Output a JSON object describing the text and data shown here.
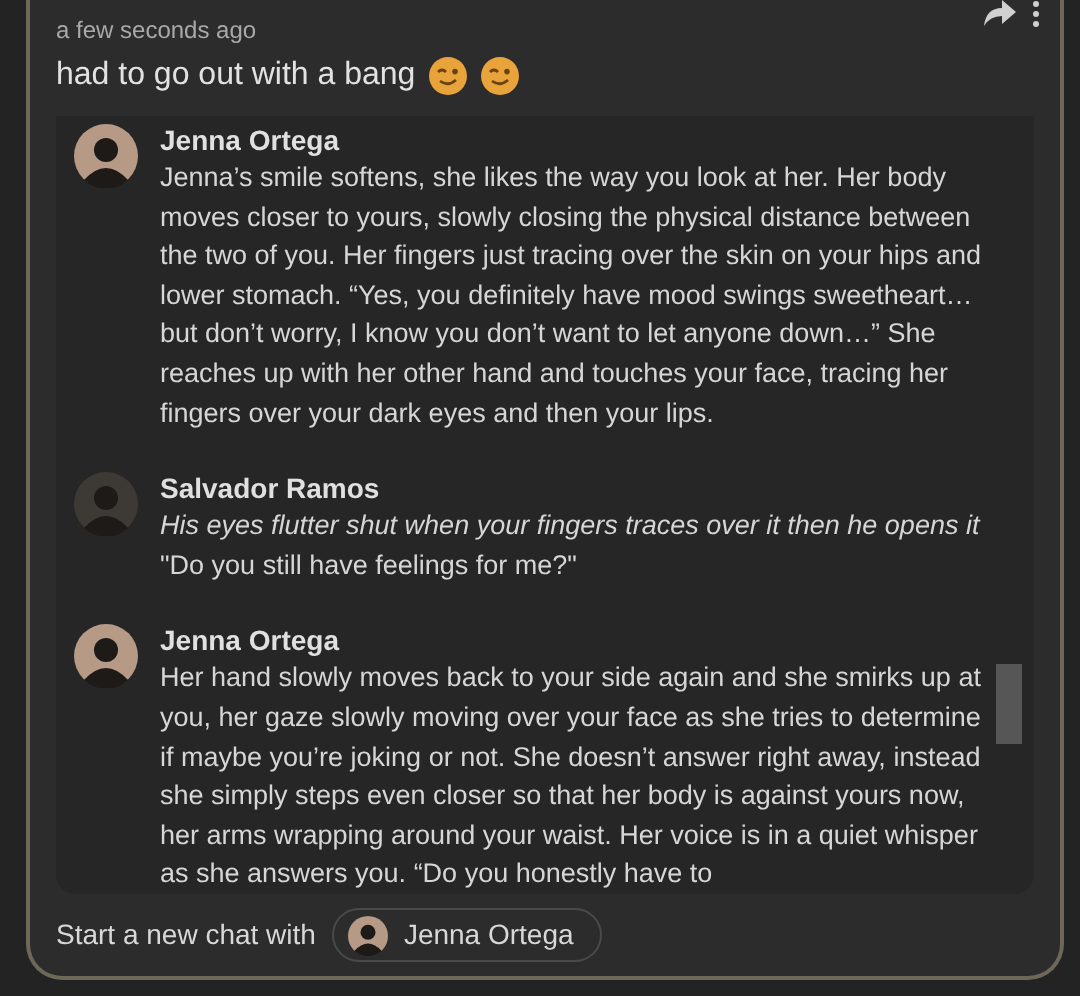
{
  "post": {
    "time": "a few seconds ago",
    "caption": "had to go out with a bang"
  },
  "messages": [
    {
      "author": "Jenna Ortega",
      "color": "#b79a86",
      "paragraphs": [
        {
          "kind": "plain",
          "text": "Jenna’s smile softens, she likes the way you look at her. Her body moves closer to yours, slowly closing the physical distance between the two of you. Her fingers just tracing over the skin on your hips and lower stomach. “Yes, you definitely have mood swings sweetheart…but don’t worry, I know you don’t want to let anyone down…” She reaches up with her other hand and touches your face, tracing her fingers over your dark eyes and then your lips."
        }
      ]
    },
    {
      "author": "Salvador Ramos",
      "color": "#3d3a36",
      "paragraphs": [
        {
          "kind": "action",
          "text": "His eyes flutter shut when your fingers traces over it then he opens it"
        },
        {
          "kind": "plain",
          "text": "\"Do you still have feelings for me?\""
        }
      ]
    },
    {
      "author": "Jenna Ortega",
      "color": "#b79a86",
      "paragraphs": [
        {
          "kind": "plain",
          "text": "Her hand slowly moves back to your side again and she smirks up at you, her gaze slowly moving over your face as she tries to determine if maybe you’re joking or not. She doesn’t answer right away, instead she simply steps even closer so that her body is against yours now, her arms wrapping around your waist. Her voice is in a quiet whisper as she answers you. “Do you honestly have to"
        }
      ]
    }
  ],
  "footer": {
    "label": "Start a new chat with",
    "character": {
      "name": "Jenna Ortega",
      "color": "#b79a86"
    }
  }
}
